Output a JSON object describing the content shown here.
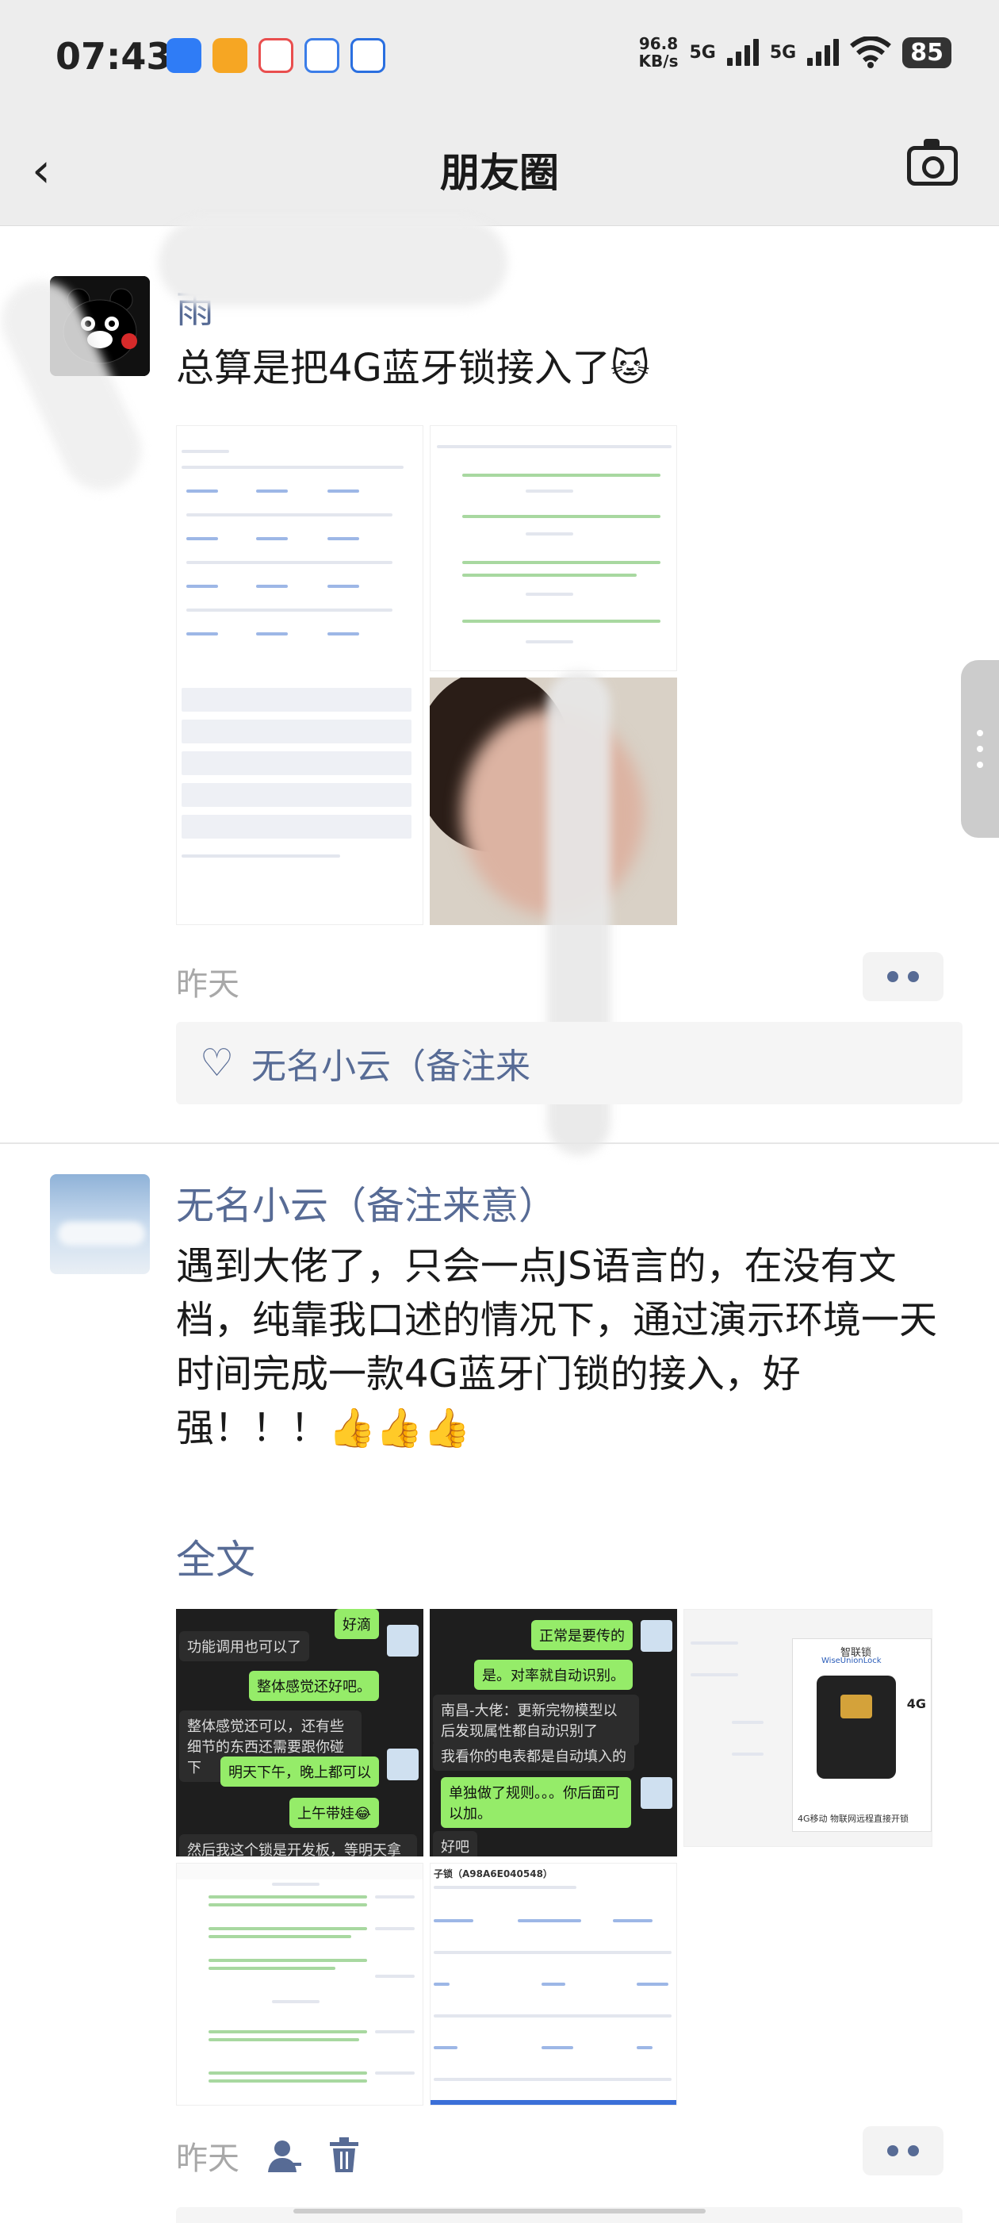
{
  "status_bar": {
    "time": "07:43",
    "net_speed_value": "96.8",
    "net_speed_unit": "KB/s",
    "signal1": "5G",
    "signal2": "5G",
    "battery": "85"
  },
  "nav": {
    "title": "朋友圈"
  },
  "post1": {
    "nickname": "雨",
    "text": "总算是把4G蓝牙锁接入了🐱",
    "time": "昨天",
    "likes": "无名小云（备注来"
  },
  "post2": {
    "nickname": "无名小云（备注来意）",
    "text": "遇到大佬了，只会一点JS语言的，在没有文档，纯靠我口述的情况下，通过演示环境一天时间完成一款4G蓝牙门锁的接入，好强！！！👍👍👍",
    "fulltext": "全文",
    "time": "昨天",
    "chat1": {
      "m1": "好滴",
      "m2": "功能调用也可以了",
      "m3": "整体感觉还好吧。",
      "m4": "整体感觉还可以，还有些细节的东西还需要跟你碰下",
      "m5": "明天下午，晚上都可以",
      "m6": "上午带娃😂",
      "m7": "然后我这个锁是开发板，等明天拿"
    },
    "chat2": {
      "m1": "正常是要传的",
      "m2": "是。对率就自动识别。",
      "m3": "南昌-大佬：更新完物模型以后发现属性都自动识别了",
      "m4": "我看你的电表都是自动填入的",
      "m5": "单独做了规则。。。你后面可以加。",
      "m6": "好吧"
    },
    "product": {
      "brand": "智联锁",
      "brand_en": "WiseUnionLock",
      "caption": "4G移动 物联网远程直接开锁",
      "badge": "4G"
    },
    "doc2_title": "子锁（A98A6E040548）"
  }
}
